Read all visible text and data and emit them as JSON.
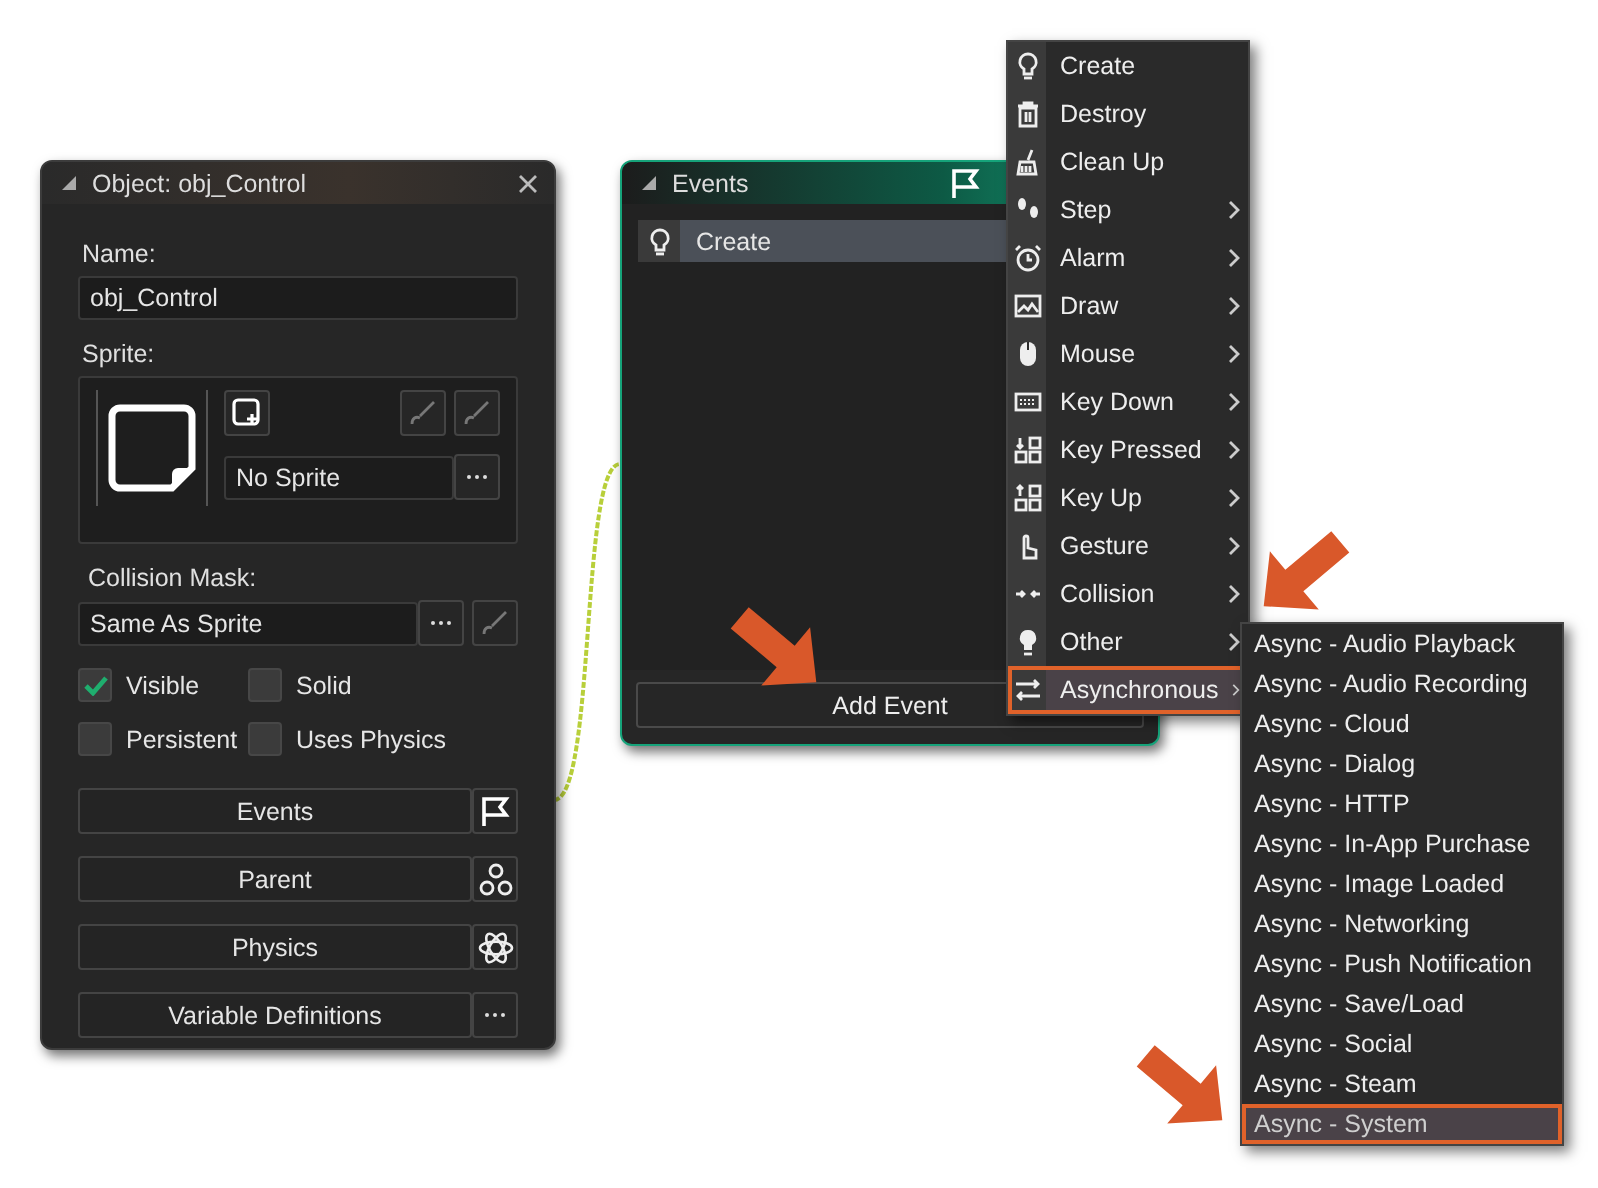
{
  "object_window": {
    "title": "Object: obj_Control",
    "name_label": "Name:",
    "name_value": "obj_Control",
    "sprite_label": "Sprite:",
    "sprite_value": "No Sprite",
    "collision_label": "Collision Mask:",
    "collision_value": "Same As Sprite",
    "checkboxes": [
      {
        "label": "Visible",
        "checked": true
      },
      {
        "label": "Solid",
        "checked": false
      },
      {
        "label": "Persistent",
        "checked": false
      },
      {
        "label": "Uses Physics",
        "checked": false
      }
    ],
    "buttons": [
      {
        "label": "Events",
        "kind": "flag"
      },
      {
        "label": "Parent",
        "kind": "parent"
      },
      {
        "label": "Physics",
        "kind": "physics"
      },
      {
        "label": "Variable Definitions",
        "kind": "more"
      }
    ]
  },
  "events_window": {
    "title": "Events",
    "events": [
      {
        "label": "Create",
        "selected": true
      }
    ],
    "add_button": "Add Event"
  },
  "event_menu": [
    {
      "label": "Create",
      "kind": "bulb",
      "submenu": false,
      "selected": false
    },
    {
      "label": "Destroy",
      "kind": "trash",
      "submenu": false,
      "selected": false
    },
    {
      "label": "Clean Up",
      "kind": "broom",
      "submenu": false,
      "selected": false
    },
    {
      "label": "Step",
      "kind": "steps",
      "submenu": true,
      "selected": false
    },
    {
      "label": "Alarm",
      "kind": "alarm",
      "submenu": true,
      "selected": false
    },
    {
      "label": "Draw",
      "kind": "image",
      "submenu": true,
      "selected": false
    },
    {
      "label": "Mouse",
      "kind": "mouse",
      "submenu": true,
      "selected": false
    },
    {
      "label": "Key Down",
      "kind": "keyboard",
      "submenu": true,
      "selected": false
    },
    {
      "label": "Key Pressed",
      "kind": "keydown",
      "submenu": true,
      "selected": false
    },
    {
      "label": "Key Up",
      "kind": "keyup",
      "submenu": true,
      "selected": false
    },
    {
      "label": "Gesture",
      "kind": "hand",
      "submenu": true,
      "selected": false
    },
    {
      "label": "Collision",
      "kind": "collide",
      "submenu": true,
      "selected": false
    },
    {
      "label": "Other",
      "kind": "bulbfill",
      "submenu": true,
      "selected": false
    },
    {
      "label": "Asynchronous",
      "kind": "swap",
      "submenu": true,
      "selected": true
    }
  ],
  "async_menu": [
    {
      "label": "Async - Audio Playback",
      "selected": false
    },
    {
      "label": "Async - Audio Recording",
      "selected": false
    },
    {
      "label": "Async - Cloud",
      "selected": false
    },
    {
      "label": "Async - Dialog",
      "selected": false
    },
    {
      "label": "Async - HTTP",
      "selected": false
    },
    {
      "label": "Async - In-App Purchase",
      "selected": false
    },
    {
      "label": "Async - Image Loaded",
      "selected": false
    },
    {
      "label": "Async - Networking",
      "selected": false
    },
    {
      "label": "Async - Push Notification",
      "selected": false
    },
    {
      "label": "Async - Save/Load",
      "selected": false
    },
    {
      "label": "Async - Social",
      "selected": false
    },
    {
      "label": "Async - Steam",
      "selected": false
    },
    {
      "label": "Async - System",
      "selected": true
    }
  ]
}
